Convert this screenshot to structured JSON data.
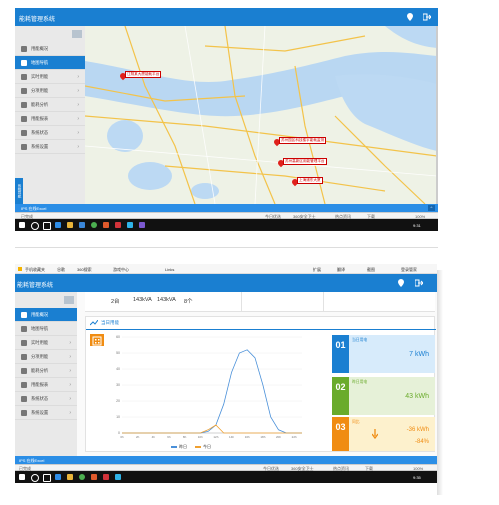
{
  "top": {
    "header_title": "能耗管理系统",
    "sidebar_items": [
      {
        "label": "用能概况",
        "active": false,
        "icon": "dashboard-icon",
        "chevron": false
      },
      {
        "label": "地图导航",
        "active": true,
        "icon": "map-pin-icon",
        "chevron": false
      },
      {
        "label": "实时用能",
        "active": false,
        "icon": "bolt-icon",
        "chevron": true
      },
      {
        "label": "分项用能",
        "active": false,
        "icon": "list-icon",
        "chevron": true
      },
      {
        "label": "能耗分析",
        "active": false,
        "icon": "analysis-icon",
        "chevron": true
      },
      {
        "label": "用能报表",
        "active": false,
        "icon": "table-icon",
        "chevron": true
      },
      {
        "label": "系统状态",
        "active": false,
        "icon": "status-icon",
        "chevron": true
      },
      {
        "label": "系统设置",
        "active": false,
        "icon": "settings-icon",
        "chevron": true
      }
    ],
    "side_vertical": "系统导航",
    "map_markers": [
      {
        "label": "江阴某大厦能耗平台"
      },
      {
        "label": "苏州园区科技楼宇能耗监测"
      },
      {
        "label": "苏州高新区用能管理平台"
      },
      {
        "label": "上海浦东大厦"
      }
    ],
    "bluebar_text": "IPS 在线Excel",
    "bluebar_button": "^",
    "status_left": "已完成",
    "status_items": [
      "今日优选",
      "360安全卫士",
      "热点资讯",
      "下载",
      "100%"
    ],
    "tray_time": "9:31"
  },
  "bottom": {
    "browser_bookmarks": [
      "手机收藏夹",
      "谷歌",
      "360搜索",
      "游戏中心",
      "Links"
    ],
    "browser_right": [
      "扩展",
      "翻译",
      "截图",
      "登录管家"
    ],
    "header_title": "能耗管理系统",
    "sidebar_items": [
      {
        "label": "用能概况",
        "active": true,
        "chevron": false
      },
      {
        "label": "地图导航",
        "active": false,
        "chevron": false
      },
      {
        "label": "实时用能",
        "active": false,
        "chevron": true
      },
      {
        "label": "分项用能",
        "active": false,
        "chevron": true
      },
      {
        "label": "能耗分析",
        "active": false,
        "chevron": true
      },
      {
        "label": "用能报表",
        "active": false,
        "chevron": true
      },
      {
        "label": "系统状态",
        "active": false,
        "chevron": true
      },
      {
        "label": "系统设置",
        "active": false,
        "chevron": true
      }
    ],
    "summary": {
      "count": "2台",
      "capacity1": "143kVA",
      "capacity2": "143kVA",
      "count2": "8个"
    },
    "panel_title": "当日用能",
    "cards": [
      {
        "num": "01",
        "caption": "当日用电",
        "value": "7 kWh",
        "color": "#1a7fd1",
        "bg": "#d7ebfb"
      },
      {
        "num": "02",
        "caption": "昨日用电",
        "value": "43 kWh",
        "color": "#6aab2b",
        "bg": "#e6f1d8"
      },
      {
        "num": "03",
        "caption": "同比",
        "value": "-36 kWh",
        "value2": "-84%",
        "color": "#f08c12",
        "bg": "#fdf1cd"
      }
    ],
    "legend": [
      "昨日",
      "今日"
    ],
    "bluebar_text": "IPS 在线Excel",
    "status_left": "已完成",
    "status_items": [
      "今日优选",
      "360安全卫士",
      "热点资讯",
      "下载",
      "100%"
    ],
    "tray_time": "9:35"
  },
  "chart_data": {
    "type": "line",
    "x_ticks": [
      "0h",
      "1h",
      "2h",
      "3h",
      "4h",
      "5h",
      "6h",
      "7h",
      "8h",
      "9h",
      "10h",
      "11h",
      "12h",
      "13h",
      "14h",
      "15h",
      "16h",
      "17h",
      "18h",
      "19h",
      "20h",
      "21h",
      "22h",
      "23h"
    ],
    "ylim": [
      0,
      60
    ],
    "y_ticks": [
      0,
      10,
      20,
      30,
      40,
      50,
      60
    ],
    "series": [
      {
        "name": "昨日",
        "color": "#4a90d9",
        "values": [
          0,
          0,
          0,
          0,
          0,
          0,
          0,
          0,
          0,
          0,
          0,
          1,
          5,
          18,
          38,
          50,
          52,
          47,
          30,
          10,
          2,
          0,
          0,
          0
        ]
      },
      {
        "name": "今日",
        "color": "#f0a030",
        "values": [
          0,
          0,
          0,
          0,
          0,
          0,
          0,
          0,
          0,
          0,
          0,
          2,
          5,
          0,
          0,
          0,
          0,
          0,
          0,
          0,
          0,
          0,
          0,
          0
        ]
      }
    ]
  }
}
